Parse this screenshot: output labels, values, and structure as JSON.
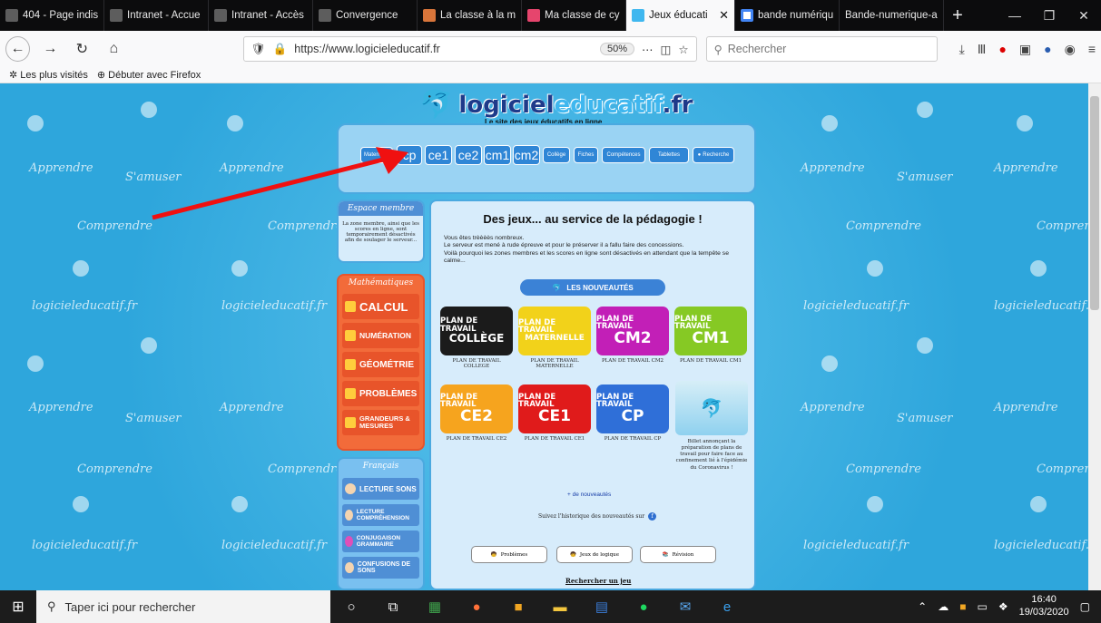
{
  "tabs": [
    {
      "label": "404 - Page indis",
      "color": "#5d5d5d"
    },
    {
      "label": "Intranet - Accue",
      "color": "#5d5d5d"
    },
    {
      "label": "Intranet - Accès",
      "color": "#5d5d5d"
    },
    {
      "label": "Convergence",
      "color": "#5d5d5d"
    },
    {
      "label": "La classe à la ma",
      "color": "#d8753a"
    },
    {
      "label": "Ma classe de cyc",
      "color": "#e6456d"
    },
    {
      "label": "Jeux éducati",
      "color": "#3fb7ef",
      "active": true
    },
    {
      "label": "bande numériqu",
      "color": "#ffffff"
    },
    {
      "label": "Bande-numerique-a",
      "color": "#1c1c1c"
    }
  ],
  "nav": {
    "url": "https://www.logicieleducatif.fr",
    "zoom": "50%",
    "search_placeholder": "Rechercher"
  },
  "bookmarks": {
    "most_visited": "Les plus visités",
    "getting_started": "Débuter avec Firefox"
  },
  "background_words": {
    "apprendre": "Apprendre",
    "samuser": "S'amuser",
    "comprendre": "Comprendre",
    "logo": "logicieleducatif.fr"
  },
  "site": {
    "logo_a": "logiciel",
    "logo_b": "educatif",
    "logo_c": ".fr",
    "tagline": "Le site des jeux éducatifs en ligne",
    "menu": [
      "Maternelle",
      "cp",
      "ce1",
      "ce2",
      "cm1",
      "cm2",
      "Collège",
      "Fiches",
      "Compétences",
      "Tablettes",
      "Recherche"
    ],
    "espace": {
      "title": "Espace membre",
      "text": "La zone membre, ainsi que les scores en ligne, sont temporairement désactivés afin de soulager le serveur..."
    },
    "maths": {
      "title": "Mathématiques",
      "items": [
        "CALCUL",
        "NUMÉRATION",
        "GÉOMÉTRIE",
        "PROBLÈMES",
        "GRANDEURS & MESURES"
      ]
    },
    "francais": {
      "title": "Français",
      "items": [
        "LECTURE SONS",
        "LECTURE COMPRÉHENSION",
        "CONJUGAISON GRAMMAIRE",
        "CONFUSIONS DE SONS"
      ]
    },
    "headline": "Des jeux... au service de la pédagogie !",
    "intro": [
      "Vous êtes trèèèès nombreux.",
      "Le serveur est mené à rude épreuve et pour le préserver il a fallu faire des concessions.",
      "Voilà pourquoi les zones membres et les scores en ligne sont désactivés en attendant que la tempête se calme..."
    ],
    "nouveautes": "LES NOUVEAUTÉS",
    "cards": [
      {
        "top": "PLAN DE TRAVAIL",
        "big": "COLLÈGE",
        "caption": "PLAN DE TRAVAIL COLLEGE",
        "bg": "#1b1b1b"
      },
      {
        "top": "PLAN DE TRAVAIL",
        "big": "MATERNELLE",
        "caption": "PLAN DE TRAVAIL MATERNELLE",
        "bg": "#f2d21a"
      },
      {
        "top": "PLAN DE TRAVAIL",
        "big": "CM2",
        "caption": "PLAN DE TRAVAIL CM2",
        "bg": "#c21fb7"
      },
      {
        "top": "PLAN DE TRAVAIL",
        "big": "CM1",
        "caption": "PLAN DE TRAVAIL CM1",
        "bg": "#86c924"
      },
      {
        "top": "PLAN DE TRAVAIL",
        "big": "CE2",
        "caption": "PLAN DE TRAVAIL CE2",
        "bg": "#f6a41e"
      },
      {
        "top": "PLAN DE TRAVAIL",
        "big": "CE1",
        "caption": "PLAN DE TRAVAIL CE1",
        "bg": "#e01b1b"
      },
      {
        "top": "PLAN DE TRAVAIL",
        "big": "CP",
        "caption": "PLAN DE TRAVAIL CP",
        "bg": "#2f6fd8"
      }
    ],
    "billet": "Billet annonçant la préparation de plans de travail pour faire face au confinement lié à l'épidémie du Coronavirus !",
    "more": "+ de nouveautés",
    "history": "Suivez l'historique des nouveautés sur",
    "buttons": [
      "Problèmes",
      "Jeux de logique",
      "Révision"
    ],
    "search_game": "Rechercher un jeu"
  },
  "taskbar": {
    "search": "Taper ici pour rechercher",
    "time": "16:40",
    "date": "19/03/2020"
  }
}
